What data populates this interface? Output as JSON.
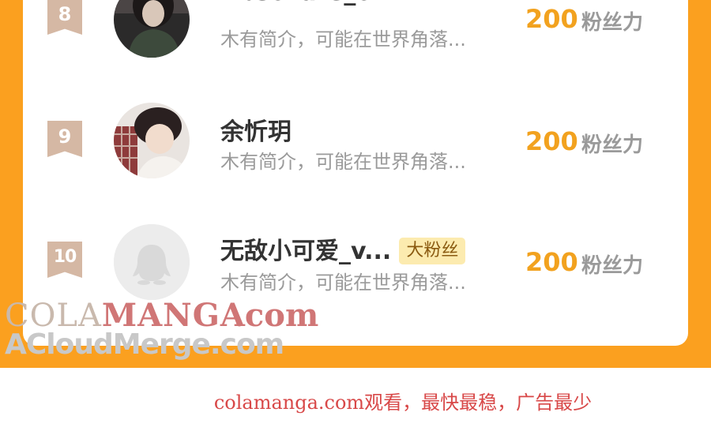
{
  "ranking": {
    "items": [
      {
        "rank": "8",
        "name": "AbsoTute_o...",
        "badge": "",
        "bio": "木有简介，可能在世界角落...",
        "score": "200",
        "unit": "粉丝力",
        "avatar": "photo-avatar"
      },
      {
        "rank": "9",
        "name": "余忻玥",
        "badge": "",
        "bio": "木有简介，可能在世界角落...",
        "score": "200",
        "unit": "粉丝力",
        "avatar": "photo-avatar"
      },
      {
        "rank": "10",
        "name": "无敌小可爱_v...",
        "badge": "大粉丝",
        "bio": "木有简介，可能在世界角落...",
        "score": "200",
        "unit": "粉丝力",
        "avatar": "default-penguin-avatar"
      }
    ]
  },
  "watermark": {
    "brand_part1": "COLA",
    "brand_part2": "MANGA",
    "domain": ".com",
    "secondary": "ACloudMerge.com"
  },
  "footer_text": "colamanga.com观看，最快最稳，广告最少",
  "colors": {
    "frame": "#fba01f",
    "score": "#f2a21f",
    "rank_ribbon": "#d5b8a4",
    "badge_bg": "#fcebaf",
    "footer": "#d84848"
  }
}
